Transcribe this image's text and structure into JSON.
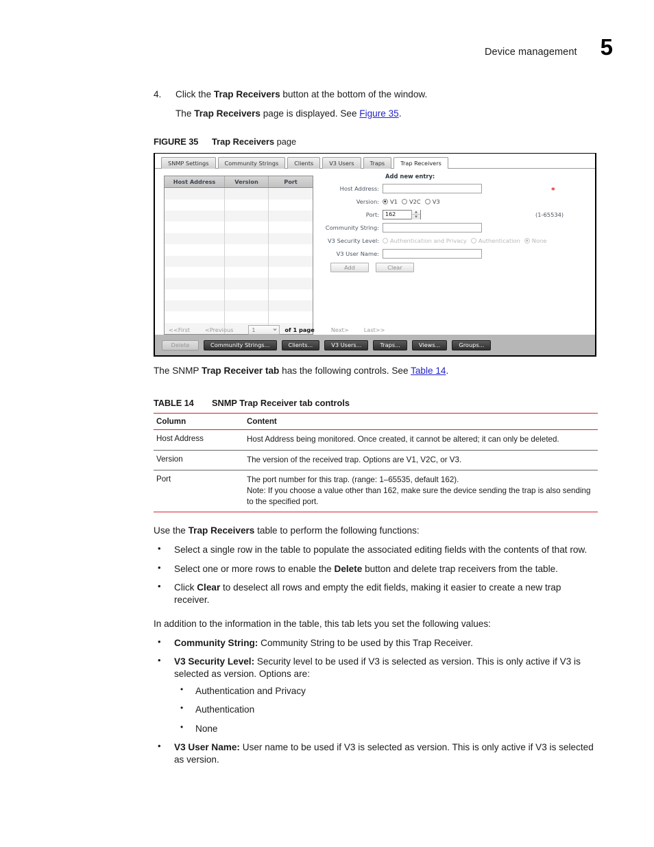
{
  "header": {
    "chapter_title": "Device management",
    "chapter_number": "5"
  },
  "step": {
    "number": "4.",
    "line1_before": "Click the ",
    "line1_bold": "Trap Receivers",
    "line1_after": " button at the bottom of the window.",
    "line2_before": "The ",
    "line2_bold": "Trap Receivers",
    "line2_mid": " page is displayed. See ",
    "line2_xref": "Figure 35",
    "line2_after": "."
  },
  "figure_caption": {
    "label": "FIGURE 35",
    "bold": "Trap Receivers",
    "rest": " page"
  },
  "screenshot": {
    "tabs": [
      {
        "label": "SNMP Settings",
        "active": false
      },
      {
        "label": "Community Strings",
        "active": false
      },
      {
        "label": "Clients",
        "active": false
      },
      {
        "label": "V3 Users",
        "active": false
      },
      {
        "label": "Traps",
        "active": false
      },
      {
        "label": "Trap Receivers",
        "active": true
      }
    ],
    "table": {
      "columns": [
        "Host Address",
        "Version",
        "Port"
      ],
      "rows": [],
      "empty_row_count": 12
    },
    "pager": {
      "first": "<<First",
      "previous": "<Previous",
      "page_value": "1",
      "of_label": "of 1 page",
      "next": "Next>",
      "last": "Last>>"
    },
    "form": {
      "heading": "Add new entry:",
      "host_address_label": "Host Address:",
      "host_address_value": "",
      "required_marker": "*",
      "version_label": "Version:",
      "version_options": [
        {
          "label": "V1",
          "selected": true
        },
        {
          "label": "V2C",
          "selected": false
        },
        {
          "label": "V3",
          "selected": false
        }
      ],
      "port_label": "Port:",
      "port_value": "162",
      "port_range": "(1-65534)",
      "community_string_label": "Community String:",
      "community_string_value": "",
      "v3_security_label": "V3 Security Level:",
      "v3_security_options": [
        {
          "label": "Authentication and Privacy",
          "selected": false
        },
        {
          "label": "Authentication",
          "selected": false
        },
        {
          "label": "None",
          "selected": true
        }
      ],
      "v3_user_label": "V3 User Name:",
      "v3_user_value": "",
      "add_button": "Add",
      "clear_button": "Clear"
    },
    "toolbar": [
      {
        "label": "Delete",
        "disabled": true
      },
      {
        "label": "Community Strings...",
        "disabled": false
      },
      {
        "label": "Clients...",
        "disabled": false
      },
      {
        "label": "V3 Users...",
        "disabled": false
      },
      {
        "label": "Traps...",
        "disabled": false
      },
      {
        "label": "Views...",
        "disabled": false
      },
      {
        "label": "Groups...",
        "disabled": false
      }
    ]
  },
  "after_figure": {
    "before": "The SNMP ",
    "bold": "Trap Receiver tab",
    "mid": " has the following controls. See ",
    "xref": "Table 14",
    "after": "."
  },
  "table_caption": {
    "label": "TABLE 14",
    "text": "SNMP Trap Receiver tab controls"
  },
  "doc_table": {
    "headers": [
      "Column",
      "Content"
    ],
    "rows": [
      {
        "column": "Host Address",
        "content": [
          "Host Address being monitored. Once created, it cannot be altered; it can only be deleted."
        ]
      },
      {
        "column": "Version",
        "content": [
          "The version of the received trap. Options are V1, V2C, or V3."
        ]
      },
      {
        "column": "Port",
        "content": [
          "The port number for this trap. (range: 1–65535, default 162).",
          "Note: If you choose a value other than 162, make sure the device sending the trap is also sending to the specified port."
        ]
      }
    ]
  },
  "functions_section": {
    "lead_before": "Use the ",
    "lead_bold": "Trap Receivers",
    "lead_after": " table to perform the following functions:",
    "items": [
      {
        "p1": "Select a single row in the table to populate the associated editing fields with the contents of that row.",
        "b": "",
        "p2": ""
      },
      {
        "p1": "Select one or more rows to enable the ",
        "b": "Delete",
        "p2": " button and delete trap receivers from the table."
      },
      {
        "p1": "Click ",
        "b": "Clear",
        "p2": " to deselect all rows and empty the edit fields, making it easier to create a new trap receiver."
      }
    ]
  },
  "values_section": {
    "lead": "In addition to the information in the table, this tab lets you set the following values:",
    "item1_bold": "Community String:",
    "item1_text": " Community String to be used by this Trap Receiver.",
    "item2_bold": "V3 Security Level:",
    "item2_text": " Security level to be used if V3 is selected as version. This is only active if V3 is selected as version. Options are:",
    "sub_items": [
      "Authentication and Privacy",
      "Authentication",
      "None"
    ],
    "item3_bold": "V3 User Name:",
    "item3_text": " User name to be used if V3 is selected as version. This is only active if V3 is selected as version."
  },
  "colors": {
    "xref": "#2222cc",
    "table_rule": "#d81f2a",
    "required": "#e02020"
  }
}
